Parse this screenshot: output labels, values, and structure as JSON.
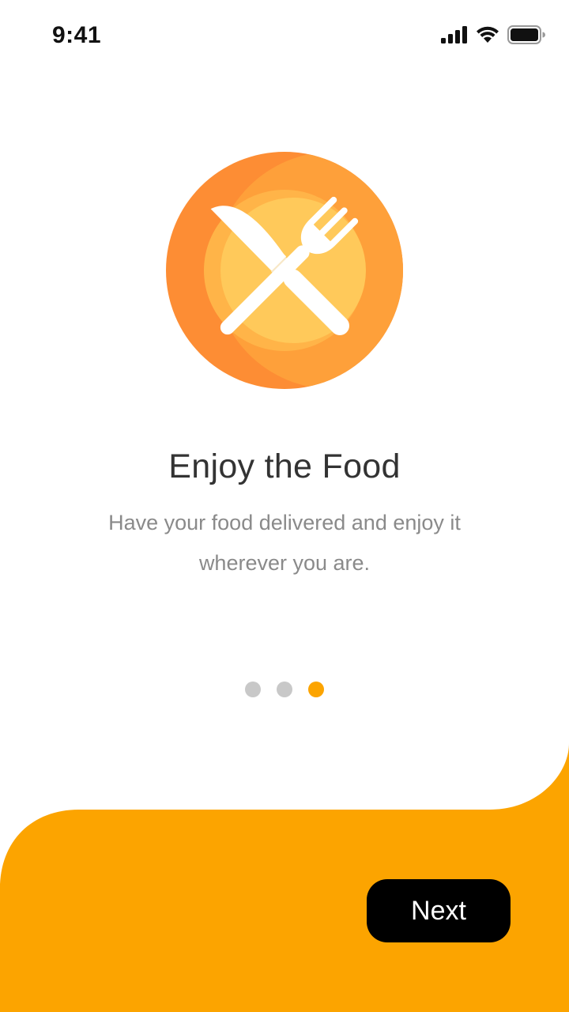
{
  "status_bar": {
    "time": "9:41",
    "icons": [
      "signal-icon",
      "wifi-icon",
      "battery-icon"
    ]
  },
  "onboarding": {
    "illustration_icon": "cutlery-plate-icon",
    "title": "Enjoy the Food",
    "subtitle": "Have your food delivered and enjoy it wherever you are.",
    "page_count": 3,
    "active_page": 3
  },
  "actions": {
    "next_label": "Next"
  },
  "colors": {
    "accent": "#FCA400",
    "plate_outer": "#FE9C3A",
    "plate_inner": "#FFC95A",
    "button_bg": "#000000",
    "title": "#333333",
    "subtitle": "#8A8A8A",
    "dot_inactive": "#C8C8C8"
  }
}
